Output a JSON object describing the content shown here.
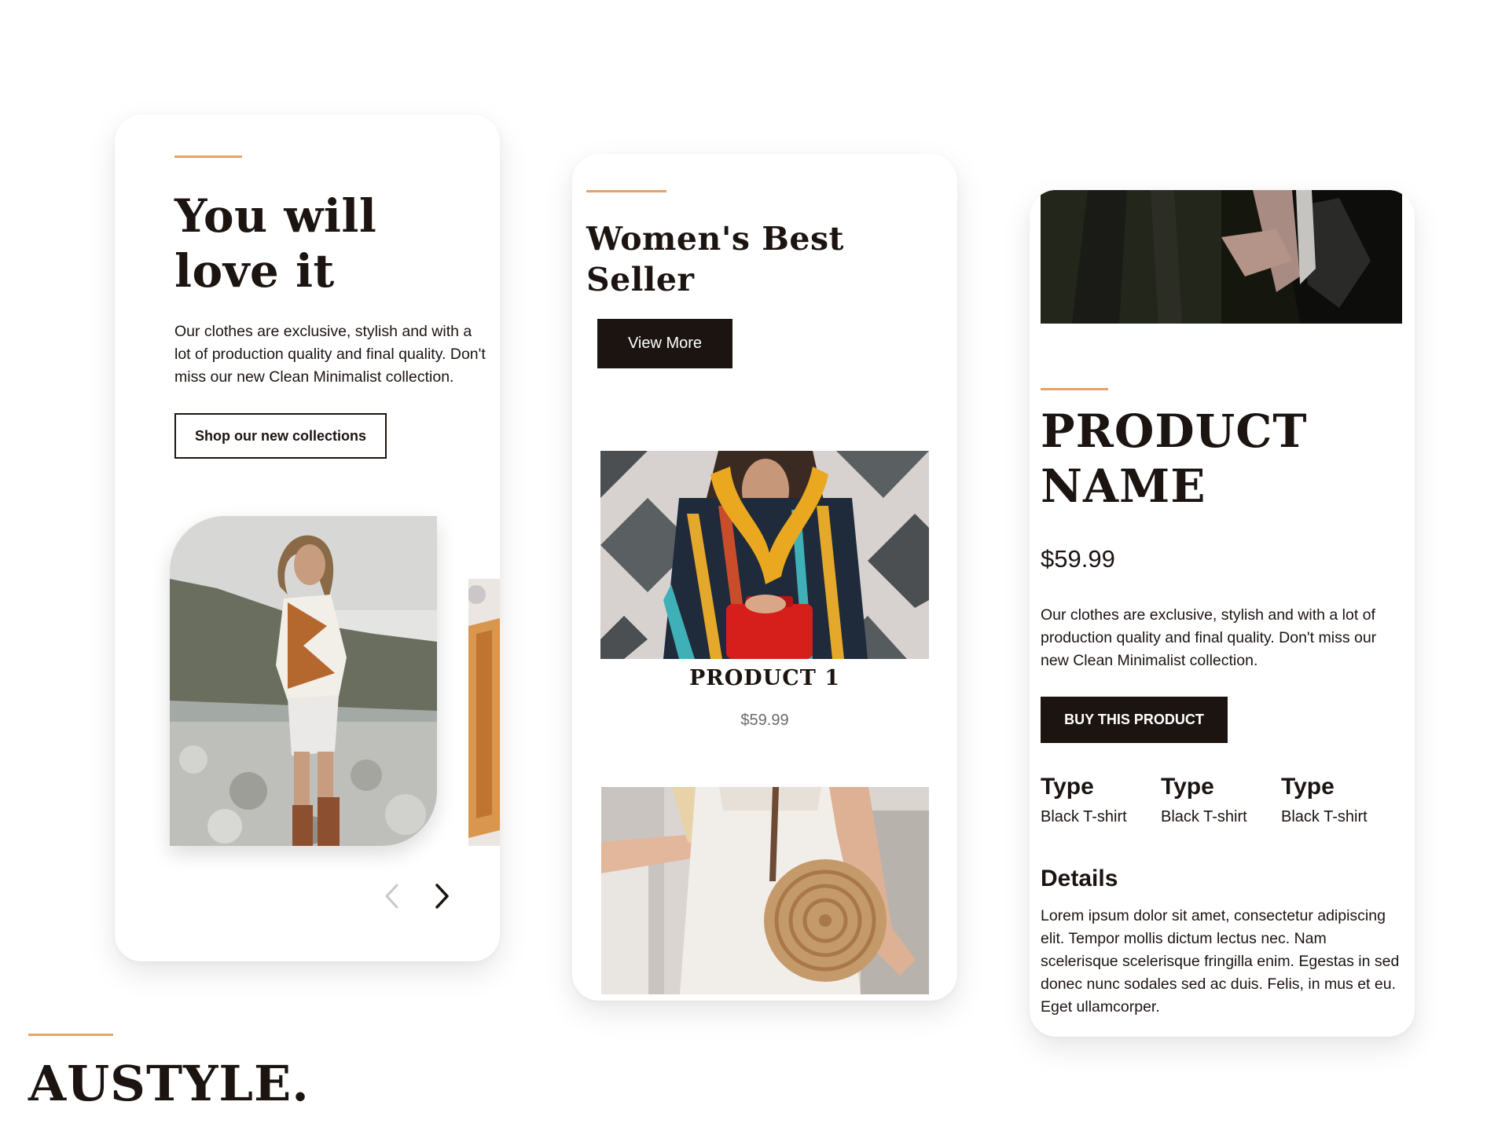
{
  "brand": {
    "name": "AUSTYLE."
  },
  "colors": {
    "accent": "#e6a26b",
    "dark": "#1c1411",
    "price_gray": "#6b6b6b"
  },
  "hero_card": {
    "title": "You will love it",
    "description": "Our clothes are exclusive, stylish and with a lot of production quality and final quality. Don't miss our new Clean Minimalist collection.",
    "cta_label": "Shop our new collections",
    "carousel_prev_icon": "chevron-left-icon",
    "carousel_next_icon": "chevron-right-icon"
  },
  "bestseller_card": {
    "title": "Women's Best Seller",
    "view_more_label": "View More",
    "products": [
      {
        "name": "PRODUCT 1",
        "price": "$59.99"
      }
    ]
  },
  "product_card": {
    "title": "PRODUCT NAME",
    "price": "$59.99",
    "description": "Our clothes are exclusive, stylish and with a lot of production quality and final quality. Don't miss our new Clean Minimalist collection.",
    "buy_label": "BUY THIS PRODUCT",
    "types": [
      {
        "label": "Type",
        "value": "Black T-shirt"
      },
      {
        "label": "Type",
        "value": "Black T-shirt"
      },
      {
        "label": "Type",
        "value": "Black T-shirt"
      }
    ],
    "details_title": "Details",
    "details_text": "Lorem ipsum dolor sit amet, consectetur adipiscing elit. Tempor mollis dictum lectus nec. Nam scelerisque scelerisque fringilla enim. Egestas in sed donec nunc sodales sed ac duis. Felis, in mus et eu. Eget ullamcorper."
  }
}
